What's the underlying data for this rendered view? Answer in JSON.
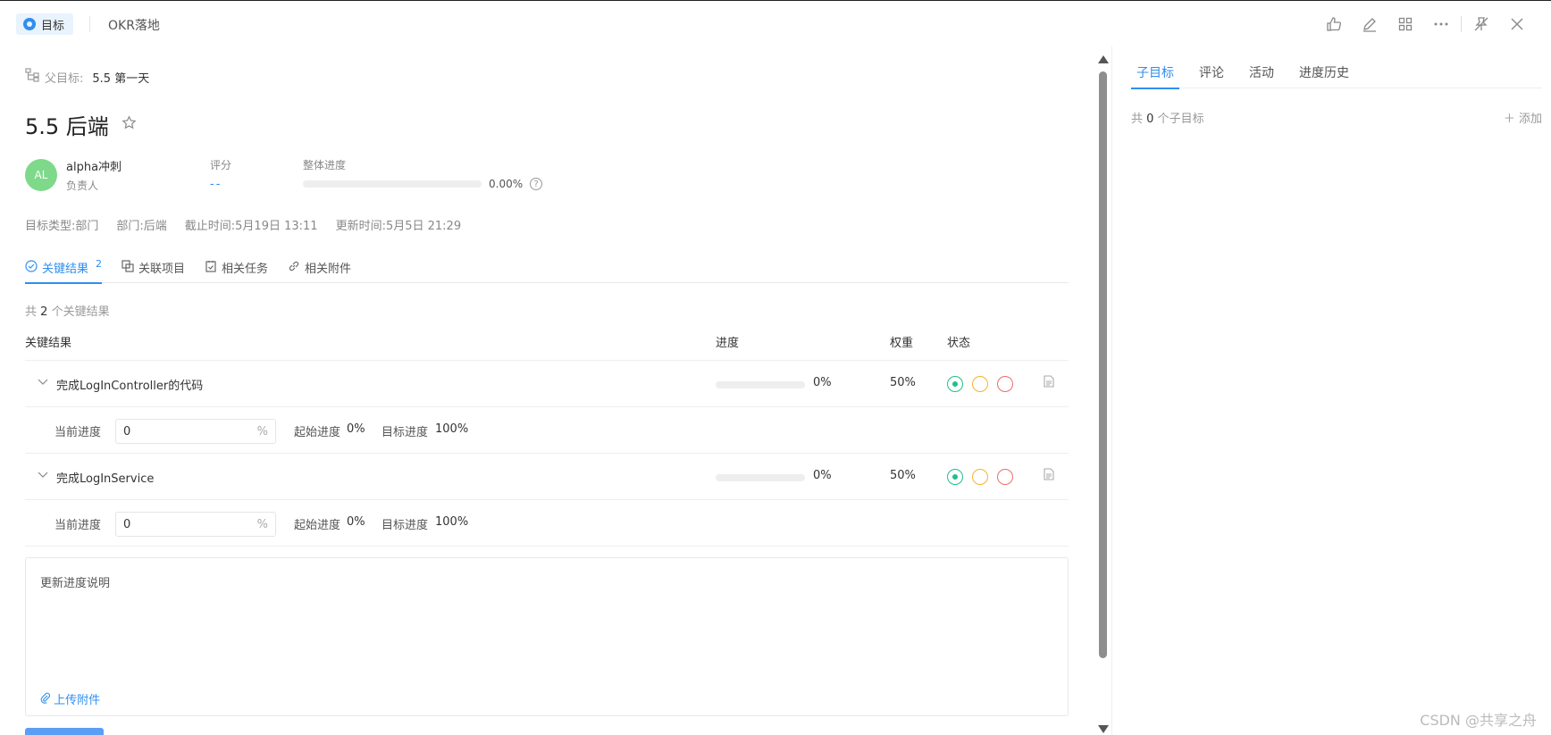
{
  "topbar": {
    "goal_tag": "目标",
    "crumb": "OKR落地",
    "actions": [
      "like-icon",
      "edit-icon",
      "grid-icon",
      "more-icon",
      "unpin-icon",
      "close-icon"
    ]
  },
  "objective": {
    "parent_label": "父目标:",
    "parent_value": "5.5 第一天",
    "title": "5.5 后端",
    "owner": {
      "avatar": "AL",
      "name": "alpha冲刺",
      "role": "负责人"
    },
    "score": {
      "label": "评分",
      "value": "--"
    },
    "overall": {
      "label": "整体进度",
      "value": "0.00%",
      "fraction": 0
    },
    "meta": {
      "type": "目标类型:部门",
      "dept": "部门:后端",
      "deadline": "截止时间:5月19日 13:11",
      "updated": "更新时间:5月5日 21:29"
    }
  },
  "tabs": [
    {
      "label": "关键结果",
      "count": "2",
      "icon": "check-circle-icon"
    },
    {
      "label": "关联项目",
      "icon": "project-icon"
    },
    {
      "label": "相关任务",
      "icon": "task-icon"
    },
    {
      "label": "相关附件",
      "icon": "link-icon"
    }
  ],
  "kr_summary": {
    "prefix": "共",
    "count": "2",
    "suffix": "个关键结果"
  },
  "kr_table": {
    "headers": {
      "name": "关键结果",
      "progress": "进度",
      "weight": "权重",
      "status": "状态"
    },
    "rows": [
      {
        "name": "完成LogInController的代码",
        "progress": "0%",
        "progress_fraction": 0,
        "weight": "50%",
        "current_label": "当前进度",
        "current_value": "0",
        "unit": "%",
        "start_label": "起始进度",
        "start_value": "0%",
        "target_label": "目标进度",
        "target_value": "100%"
      },
      {
        "name": "完成LogInService",
        "progress": "0%",
        "progress_fraction": 0,
        "weight": "50%",
        "current_label": "当前进度",
        "current_value": "0",
        "unit": "%",
        "start_label": "起始进度",
        "start_value": "0%",
        "target_label": "目标进度",
        "target_value": "100%"
      }
    ]
  },
  "update": {
    "placeholder": "更新进度说明",
    "upload": "上传附件"
  },
  "right": {
    "tabs": [
      "子目标",
      "评论",
      "活动",
      "进度历史"
    ],
    "count_prefix": "共",
    "count": "0",
    "count_suffix": "个子目标",
    "add": "添加"
  },
  "watermark": "CSDN @共享之舟",
  "colors": {
    "accent": "#2f8ef0",
    "green": "#1fbf8f",
    "yellow": "#f5b230",
    "red": "#f26b6b",
    "avatar": "#7ed98a"
  }
}
